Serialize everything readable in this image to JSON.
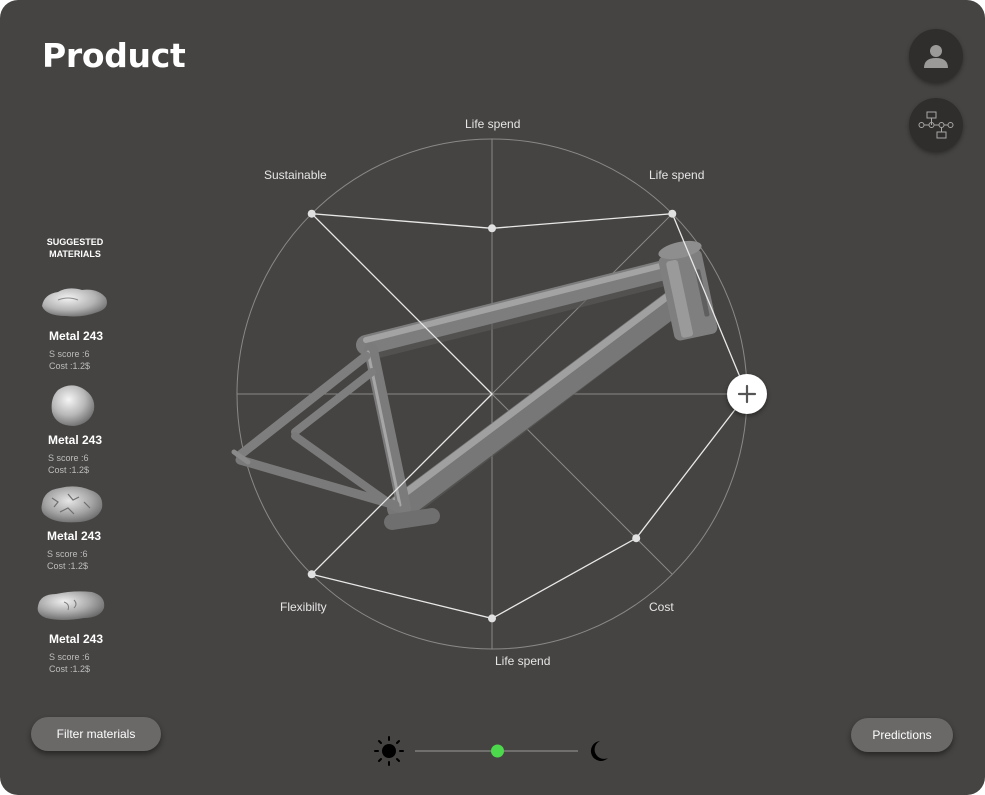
{
  "page": {
    "title": "Product"
  },
  "header": {
    "profile_icon": "user-icon",
    "workflow_icon": "flowchart-icon"
  },
  "radar": {
    "axes": [
      {
        "label": "Life spend",
        "value": 0.65
      },
      {
        "label": "Life spend",
        "value": 1.0
      },
      {
        "label": "",
        "value": 1.0
      },
      {
        "label": "Cost",
        "value": 0.8
      },
      {
        "label": "Life spend",
        "value": 0.88
      },
      {
        "label": "Flexibilty",
        "value": 1.0
      },
      {
        "label": "",
        "value": 0.0
      },
      {
        "label": "Sustainable",
        "value": 1.0
      }
    ],
    "colors": {
      "grid": "#8a8988",
      "polygon": "#e8e8e8",
      "point": "#e0e0e0"
    },
    "add_icon": "plus-icon"
  },
  "sidebar": {
    "title": "SUGGESTED MATERIALS",
    "materials": [
      {
        "name": "Metal 243",
        "score": "S score :6",
        "cost": "Cost :1.2$"
      },
      {
        "name": "Metal 243",
        "score": "S score :6",
        "cost": "Cost :1.2$"
      },
      {
        "name": "Metal 243",
        "score": "S score :6",
        "cost": "Cost :1.2$"
      },
      {
        "name": "Metal 243",
        "score": "S score :6",
        "cost": "Cost :1.2$"
      }
    ]
  },
  "footer": {
    "filter_label": "Filter materials",
    "predictions_label": "Predictions",
    "theme_slider": {
      "light_icon": "sun-icon",
      "dark_icon": "moon-icon",
      "value": 0.5,
      "accent": "#4cd94c"
    }
  }
}
